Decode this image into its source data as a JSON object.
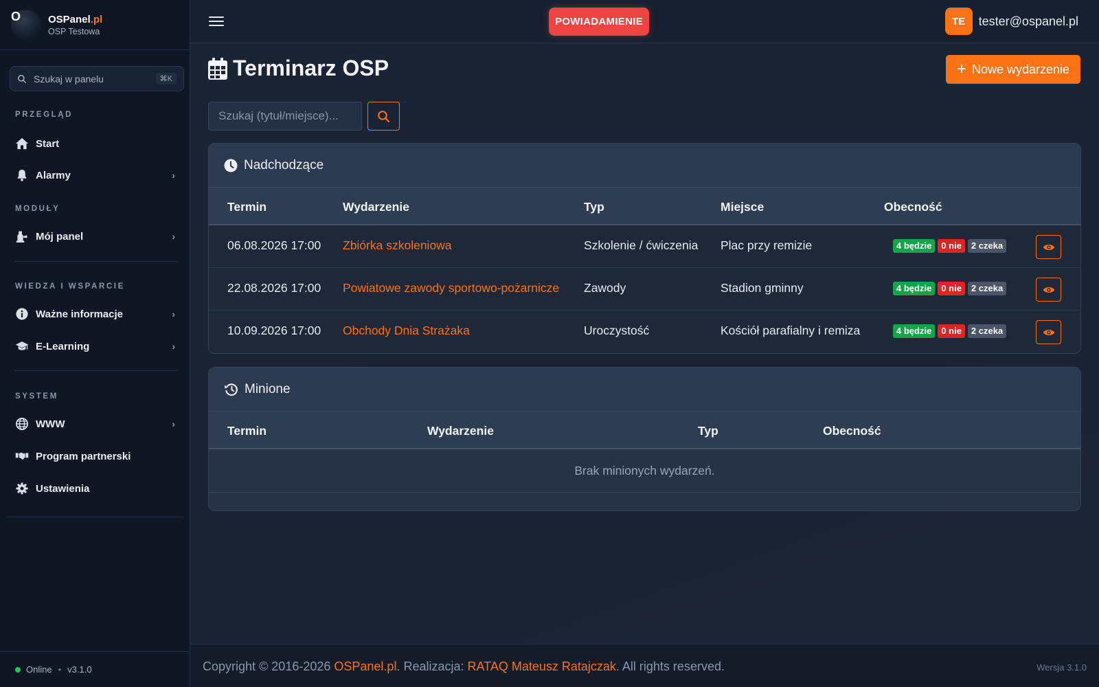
{
  "brand": {
    "name": "OSPanel",
    "tld": ".pl",
    "subtitle": "OSP Testowa",
    "logo_text": "O"
  },
  "sidebar": {
    "search_placeholder": "Szukaj w panelu",
    "search_shortcut": "⌘K",
    "sections": [
      {
        "title": "PRZEGLĄD"
      },
      {
        "title": "MODUŁY"
      },
      {
        "title": "WIEDZA I WSPARCIE"
      },
      {
        "title": "SYSTEM"
      }
    ],
    "items": [
      {
        "label": "Start",
        "icon": "home-icon"
      },
      {
        "label": "Alarmy",
        "icon": "bell-icon"
      },
      {
        "label": "Mój panel",
        "icon": "hydrant-icon"
      },
      {
        "label": "Ważne informacje",
        "icon": "info-icon"
      },
      {
        "label": "E-Learning",
        "icon": "graduation-cap-icon"
      },
      {
        "label": "WWW",
        "icon": "globe-icon"
      },
      {
        "label": "Program partnerski",
        "icon": "handshake-icon"
      },
      {
        "label": "Ustawienia",
        "icon": "gear-icon"
      }
    ],
    "status": "Online",
    "version": "v3.1.0"
  },
  "topbar": {
    "notification_label": "POWIADAMIENIE",
    "user_initials": "TE",
    "user_email": "tester@ospanel.pl"
  },
  "page": {
    "title": "Terminarz OSP",
    "new_event_label": "Nowe wydarzenie",
    "search_placeholder": "Szukaj (tytuł/miejsce)..."
  },
  "upcoming": {
    "title": "Nadchodzące",
    "headers": {
      "date": "Termin",
      "event": "Wydarzenie",
      "type": "Typ",
      "place": "Miejsce",
      "attendance": "Obecność"
    },
    "rows": [
      {
        "date": "06.08.2026 17:00",
        "event": "Zbiórka szkoleniowa",
        "type": "Szkolenie / ćwiczenia",
        "place": "Plac przy remizie",
        "yes": "4 będzie",
        "no": "0 nie",
        "wait": "2 czeka"
      },
      {
        "date": "22.08.2026 17:00",
        "event": "Powiatowe zawody sportowo-pożarnicze",
        "type": "Zawody",
        "place": "Stadion gminny",
        "yes": "4 będzie",
        "no": "0 nie",
        "wait": "2 czeka"
      },
      {
        "date": "10.09.2026 17:00",
        "event": "Obchody Dnia Strażaka",
        "type": "Uroczystość",
        "place": "Kościół parafialny i remiza",
        "yes": "4 będzie",
        "no": "0 nie",
        "wait": "2 czeka"
      }
    ]
  },
  "past": {
    "title": "Minione",
    "headers": {
      "date": "Termin",
      "event": "Wydarzenie",
      "type": "Typ",
      "attendance": "Obecność"
    },
    "empty": "Brak minionych wydarzeń."
  },
  "footer": {
    "copy_prefix": "Copyright © 2016-2026 ",
    "brand_link": "OSPanel.pl",
    "copy_mid": ". Realizacja: ",
    "author_link": "RATAQ Mateusz Ratajczak",
    "copy_suffix": ". All rights reserved.",
    "version": "Wersja 3.1.0"
  },
  "colors": {
    "accent": "#f97316",
    "danger": "#ef4444",
    "success": "#16a34a",
    "online": "#22c55e"
  }
}
